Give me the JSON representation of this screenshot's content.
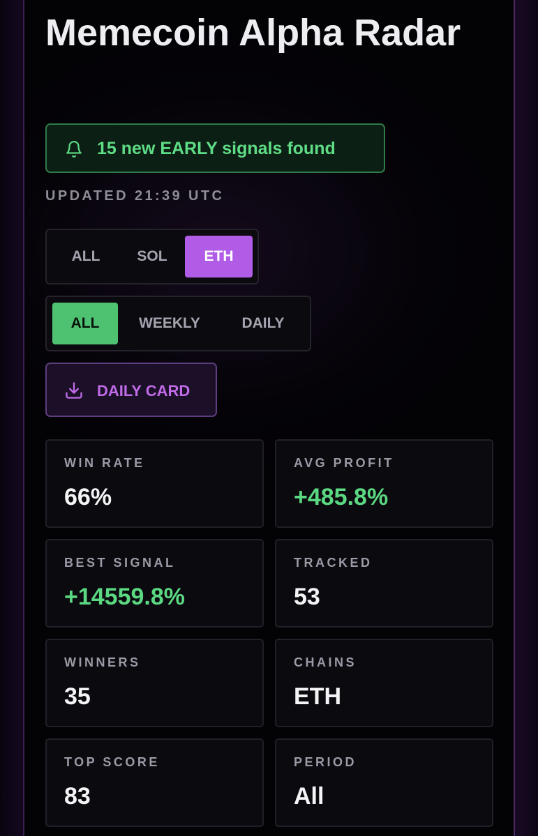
{
  "header": {
    "title": "Memecoin Alpha Radar"
  },
  "alert": {
    "icon": "bell-icon",
    "text": "15 new EARLY signals found",
    "color": "#5fdd86"
  },
  "updated": {
    "text": "UPDATED 21:39 UTC"
  },
  "chain_filter": {
    "options": [
      "ALL",
      "SOL",
      "ETH"
    ],
    "selected": "ETH"
  },
  "period_filter": {
    "options": [
      "ALL",
      "WEEKLY",
      "DAILY"
    ],
    "selected": "ALL"
  },
  "daily_card": {
    "icon": "download-icon",
    "label": "DAILY CARD"
  },
  "stats": [
    {
      "label": "WIN RATE",
      "value": "66%",
      "positive": false
    },
    {
      "label": "AVG PROFIT",
      "value": "+485.8%",
      "positive": true
    },
    {
      "label": "BEST SIGNAL",
      "value": "+14559.8%",
      "positive": true
    },
    {
      "label": "TRACKED",
      "value": "53",
      "positive": false
    },
    {
      "label": "WINNERS",
      "value": "35",
      "positive": false
    },
    {
      "label": "CHAINS",
      "value": "ETH",
      "positive": false
    },
    {
      "label": "TOP SCORE",
      "value": "83",
      "positive": false
    },
    {
      "label": "PERIOD",
      "value": "All",
      "positive": false
    }
  ],
  "colors": {
    "accent_purple": "#b05ce6",
    "accent_green": "#4fc272",
    "positive_text": "#5bd882",
    "background": "#000000"
  }
}
